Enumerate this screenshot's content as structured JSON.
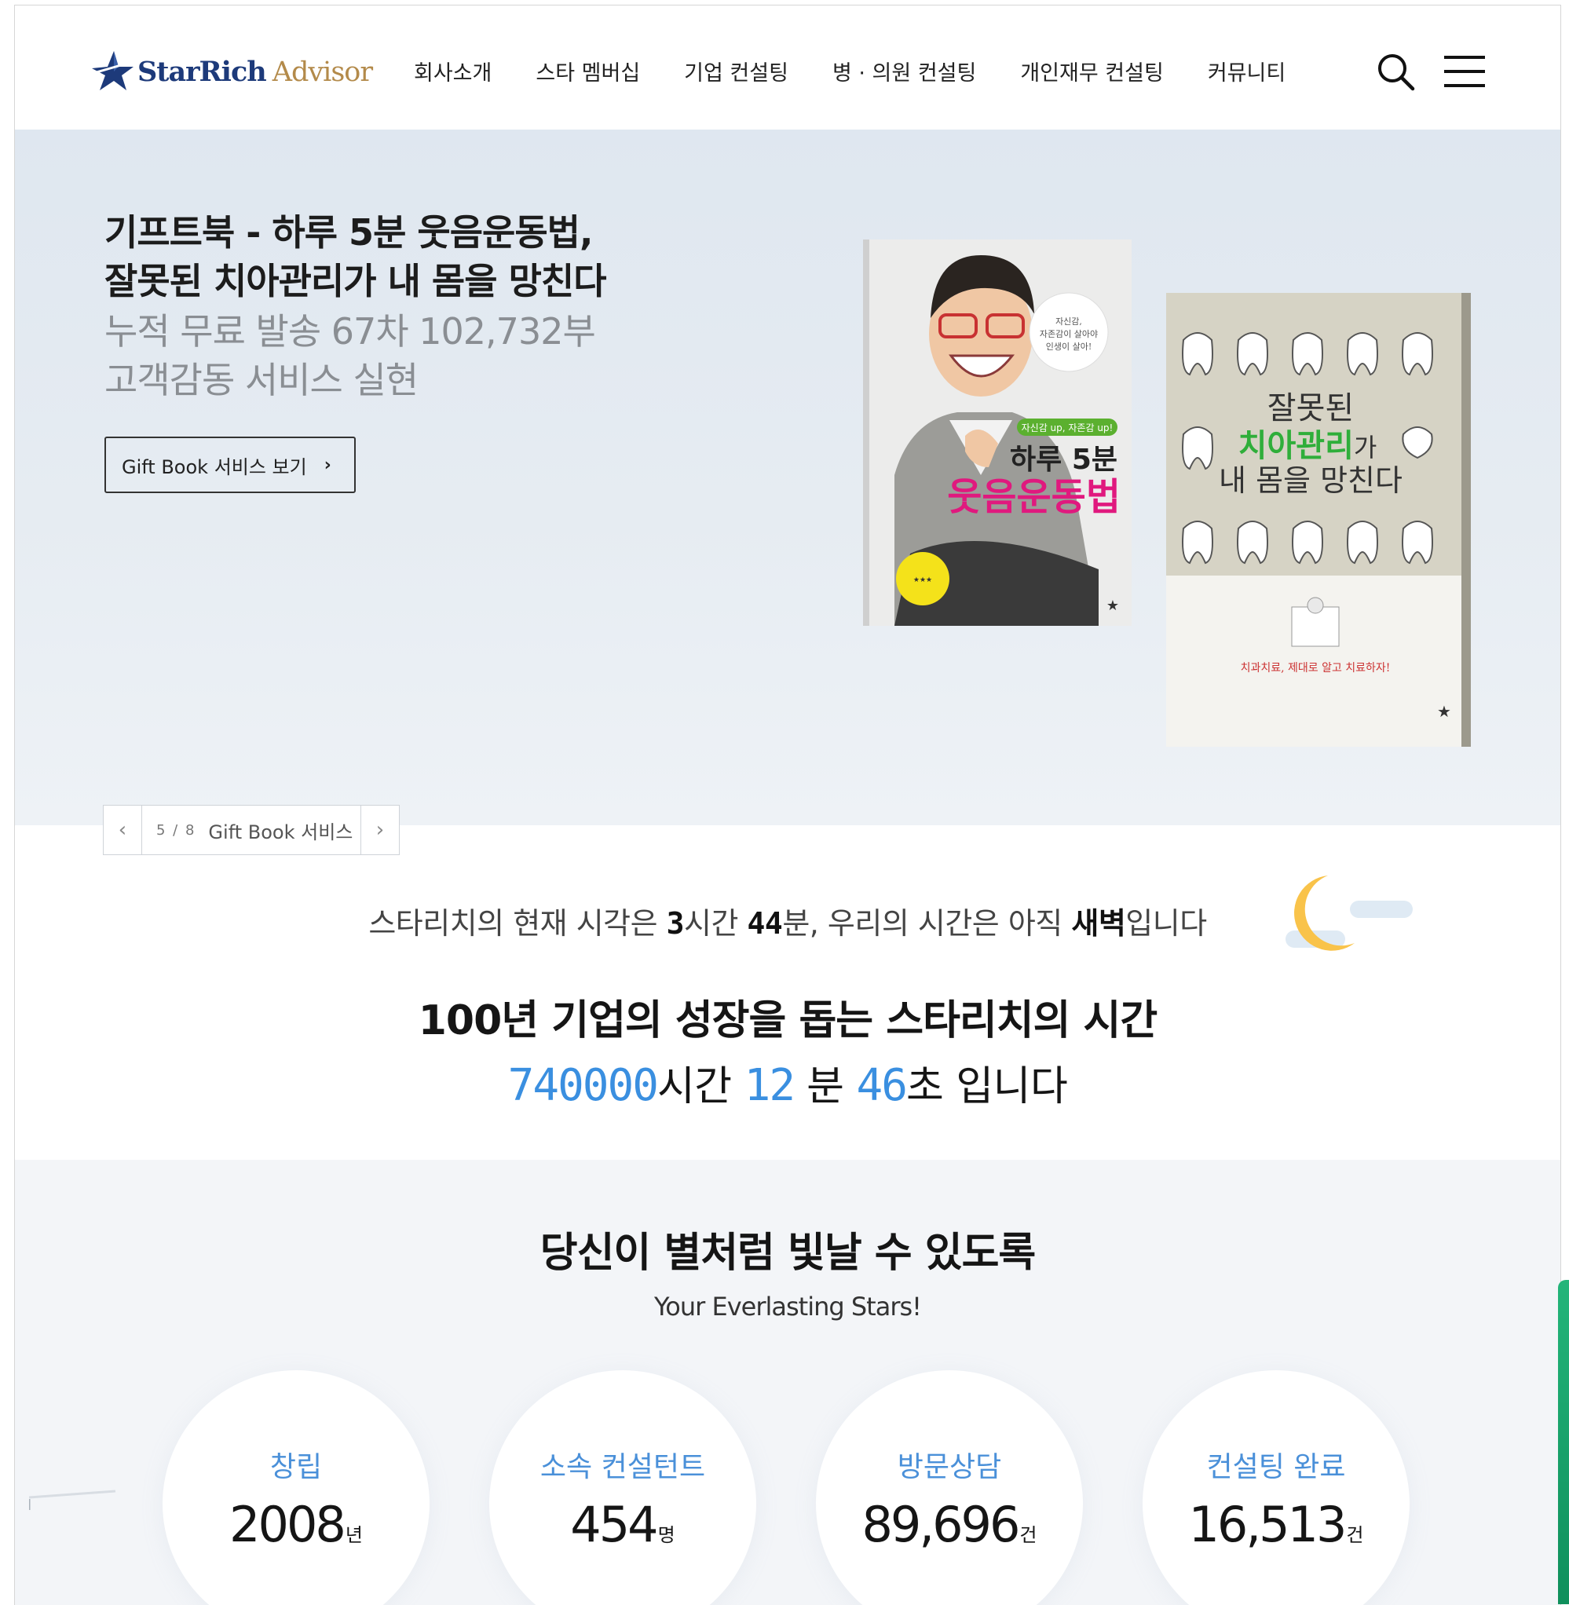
{
  "header": {
    "logo": {
      "brand": "StarRich",
      "suffix": "Advisor"
    },
    "nav": [
      "회사소개",
      "스타 멤버십",
      "기업 컨설팅",
      "병 · 의원 컨설팅",
      "개인재무 컨설팅",
      "커뮤니티"
    ],
    "icons": {
      "search": "search-icon",
      "menu": "hamburger-menu-icon"
    }
  },
  "hero": {
    "title_line1": "기프트북 - 하루 5분 웃음운동법,",
    "title_line2": "잘못된 치아관리가 내 몸을 망친다",
    "sub_line1": "누적 무료 발송 67차 102,732부",
    "sub_line2": "고객감동 서비스 실현",
    "button_label": "Gift Book 서비스 보기",
    "book1": {
      "badge": "자신감 up, 자존감 up!",
      "title_top": "하루 5분",
      "title_main": "웃음운동법",
      "quote": "자신감, 자존감이 살아야 인생이 살아!"
    },
    "book2": {
      "title_l1": "잘못된",
      "title_l2a": "치아관리",
      "title_l2b": "가",
      "title_l3": "내 몸을 망친다",
      "tagline": "치과치료, 제대로 알고 치료하자!"
    },
    "slider": {
      "counter": "5 / 8",
      "label": "Gift Book 서비스"
    }
  },
  "time": {
    "pre": "스타리치의 현재 시각은 ",
    "hour": "3",
    "mid1": "시간 ",
    "minute": "44",
    "mid2": "분, 우리의 시간은 아직 ",
    "period": "새벽",
    "post": "입니다",
    "headline": "100년 기업의 성장을 돕는 스타리치의 시간",
    "count_hours": "740000",
    "count_hours_unit": "시간 ",
    "count_minutes": "12",
    "count_minutes_unit": " 분 ",
    "count_seconds": "46",
    "count_seconds_unit": "초 입니다"
  },
  "stats": {
    "title": "당신이 별처럼 빛날 수 있도록",
    "subtitle": "Your Everlasting Stars!",
    "items": [
      {
        "label": "창립",
        "value": "2008",
        "unit": "년"
      },
      {
        "label": "소속 컨설턴트",
        "value": "454",
        "unit": "명"
      },
      {
        "label": "방문상담",
        "value": "89,696",
        "unit": "건"
      },
      {
        "label": "컨설팅 완료",
        "value": "16,513",
        "unit": "건"
      }
    ]
  },
  "colors": {
    "accent": "#3a8fe0",
    "navy": "#1d3a7a",
    "gold": "#b38a4a",
    "hero_bg": "#e3eaf2",
    "stats_bg": "#f3f5f8"
  }
}
